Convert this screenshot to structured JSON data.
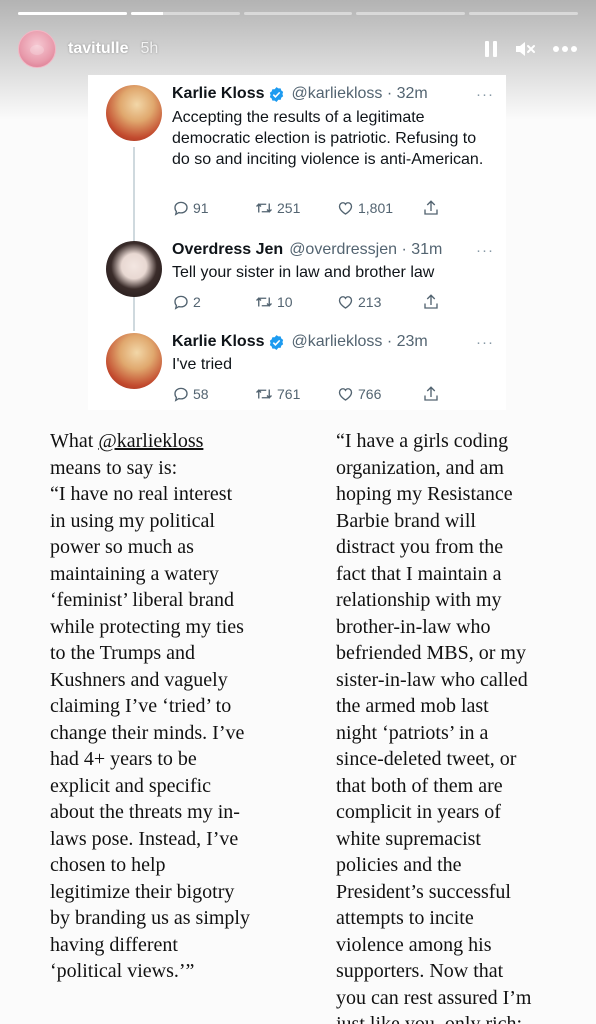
{
  "story": {
    "username": "tavitulle",
    "time_ago": "5h",
    "progress": [
      1.0,
      0.3,
      0,
      0,
      0
    ],
    "controls": [
      "pause-icon",
      "mute-icon",
      "more-icon"
    ]
  },
  "tweets": [
    {
      "name": "Karlie Kloss",
      "verified": true,
      "handle": "@karliekloss · 32m",
      "more": "···",
      "text": "Accepting the results of a legitimate democratic election is patriotic. Refusing to do so and inciting violence is anti-American.",
      "replies": "91",
      "retweets": "251",
      "likes": "1,801"
    },
    {
      "name": "Overdress Jen",
      "verified": false,
      "handle": "@overdressjen · 31m",
      "more": "···",
      "text": "Tell your sister in law and brother law",
      "replies": "2",
      "retweets": "10",
      "likes": "213"
    },
    {
      "name": "Karlie Kloss",
      "verified": true,
      "handle": "@karliekloss · 23m",
      "more": "···",
      "text": "I've tried",
      "replies": "58",
      "retweets": "761",
      "likes": "766"
    }
  ],
  "commentary": {
    "left_prefix": "What ",
    "left_mention": "@karliekloss",
    "left_body": "means to say is:\n“I have no real interest\nin using my political\npower so much as\nmaintaining a watery\n‘feminist’ liberal brand\nwhile protecting my ties\nto the Trumps and\nKushners and vaguely\nclaiming I’ve ‘tried’ to\nchange their minds. I’ve\nhad 4+ years to be\nexplicit and specific\nabout the threats my in-\nlaws pose. Instead, I’ve\nchosen to help\nlegitimize their bigotry\nby branding us as simply\nhaving different\n‘political views.’”",
    "right_body": "“I have a girls coding\norganization, and am\nhoping my Resistance\nBarbie brand will\ndistract you from the\nfact that I maintain a\nrelationship with my\nbrother-in-law who\nbefriended MBS, or my\nsister-in-law who called\nthe armed mob last\nnight ‘patriots’ in a\nsince-deleted tweet, or\nthat both of them are\ncomplicit in years of\nwhite supremacist\npolicies and the\nPresident’s successful\nattempts to incite\nviolence among his\nsupporters. Now that\nyou can rest assured I’m\njust like you, only rich:\nBuy my Adidas line.”"
  }
}
